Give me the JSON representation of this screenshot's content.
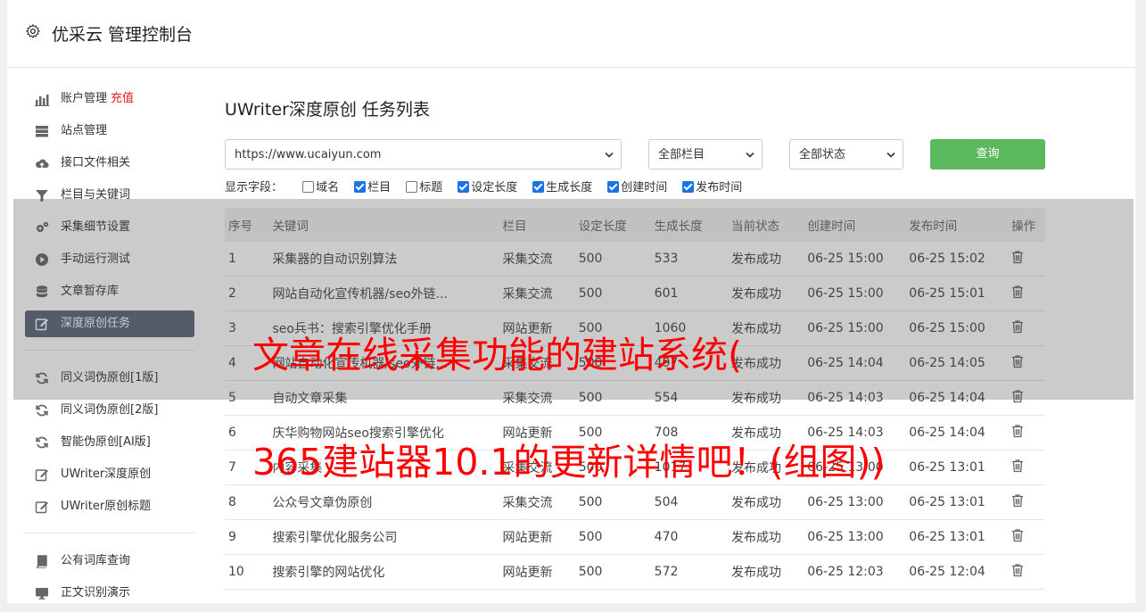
{
  "header": {
    "title": "优采云 管理控制台",
    "icon": "gear-icon"
  },
  "sidebar": {
    "group1": [
      {
        "label": "账户管理",
        "extra": "充值",
        "icon": "bar-chart-icon"
      },
      {
        "label": "站点管理",
        "icon": "server-icon"
      },
      {
        "label": "接口文件相关",
        "icon": "cloud-upload-icon"
      },
      {
        "label": "栏目与关键词",
        "icon": "filter-icon"
      },
      {
        "label": "采集细节设置",
        "icon": "gears-icon"
      },
      {
        "label": "手动运行测试",
        "icon": "play-icon"
      },
      {
        "label": "文章暂存库",
        "icon": "database-icon"
      },
      {
        "label": "深度原创任务",
        "icon": "edit-icon",
        "active": true
      }
    ],
    "group2": [
      {
        "label": "同义词伪原创[1版]",
        "icon": "refresh-icon"
      },
      {
        "label": "同义词伪原创[2版]",
        "icon": "refresh-icon"
      },
      {
        "label": "智能伪原创[AI版]",
        "icon": "refresh-icon"
      },
      {
        "label": "UWriter深度原创",
        "icon": "edit-icon"
      },
      {
        "label": "UWriter原创标题",
        "icon": "edit-icon"
      }
    ],
    "group3": [
      {
        "label": "公有词库查询",
        "icon": "book-icon"
      },
      {
        "label": "正文识别演示",
        "icon": "monitor-icon"
      }
    ]
  },
  "main": {
    "title": "UWriter深度原创 任务列表",
    "site_select": "https://www.ucaiyun.com",
    "column_select": "全部栏目",
    "status_select": "全部状态",
    "query_label": "查询",
    "fields_label": "显示字段：",
    "fields": [
      {
        "label": "域名",
        "checked": false
      },
      {
        "label": "栏目",
        "checked": true
      },
      {
        "label": "标题",
        "checked": false
      },
      {
        "label": "设定长度",
        "checked": true
      },
      {
        "label": "生成长度",
        "checked": true
      },
      {
        "label": "创建时间",
        "checked": true
      },
      {
        "label": "发布时间",
        "checked": true
      }
    ],
    "table": {
      "headers": [
        "序号",
        "关键词",
        "栏目",
        "设定长度",
        "生成长度",
        "当前状态",
        "创建时间",
        "发布时间",
        "操作"
      ],
      "rows": [
        [
          "1",
          "采集器的自动识别算法",
          "采集交流",
          "500",
          "533",
          "发布成功",
          "06-25 15:00",
          "06-25 15:02"
        ],
        [
          "2",
          "网站自动化宣传机器/seo外链...",
          "采集交流",
          "500",
          "601",
          "发布成功",
          "06-25 15:00",
          "06-25 15:01"
        ],
        [
          "3",
          "seo兵书：搜索引擎优化手册",
          "网站更新",
          "500",
          "1060",
          "发布成功",
          "06-25 15:00",
          "06-25 15:00"
        ],
        [
          "4",
          "网站自动化宣传机器/seo外链...",
          "采集交流",
          "500",
          "497",
          "发布成功",
          "06-25 14:04",
          "06-25 14:05"
        ],
        [
          "5",
          "自动文章采集",
          "采集交流",
          "500",
          "554",
          "发布成功",
          "06-25 14:03",
          "06-25 14:04"
        ],
        [
          "6",
          "庆华购物网站seo搜索引擎优化",
          "网站更新",
          "500",
          "708",
          "发布成功",
          "06-25 14:03",
          "06-25 14:04"
        ],
        [
          "7",
          "内容采集",
          "采集交流",
          "500",
          "1017",
          "发布成功",
          "06-25 13:00",
          "06-25 13:01"
        ],
        [
          "8",
          "公众号文章伪原创",
          "采集交流",
          "500",
          "504",
          "发布成功",
          "06-25 13:00",
          "06-25 13:01"
        ],
        [
          "9",
          "搜索引擎优化服务公司",
          "网站更新",
          "500",
          "470",
          "发布成功",
          "06-25 13:00",
          "06-25 13:01"
        ],
        [
          "10",
          "搜索引擎的网站优化",
          "网站更新",
          "500",
          "572",
          "发布成功",
          "06-25 12:03",
          "06-25 12:04"
        ]
      ]
    }
  },
  "overlay": {
    "line1": "文章在线采集功能的建站系统(",
    "line2": "365建站器10.1的更新详情吧！(组图))"
  },
  "colors": {
    "accent_green": "#5cb85c",
    "active_sidebar": "#5a6478",
    "overlay_text": "#ff0000",
    "status_ok": "#2e9e2e"
  }
}
